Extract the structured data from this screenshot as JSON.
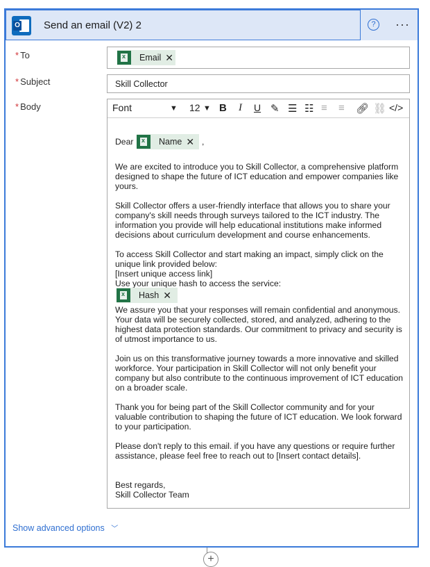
{
  "header": {
    "title": "Send an email (V2) 2",
    "help_glyph": "?",
    "more_glyph": "···"
  },
  "fields": {
    "to": {
      "label": "To",
      "required_mark": "*",
      "chip": "Email"
    },
    "subject": {
      "label": "Subject",
      "required_mark": "*",
      "value": "Skill Collector"
    },
    "body": {
      "label": "Body",
      "required_mark": "*"
    }
  },
  "toolbar": {
    "font": "Font",
    "size": "12",
    "bold": "B",
    "italic": "I",
    "underline": "U",
    "code": "</>"
  },
  "body": {
    "dear": "Dear",
    "name_chip": "Name",
    "comma": ",",
    "p1": "We are excited to introduce you to Skill Collector, a comprehensive platform\ndesigned to shape the future of ICT education and empower companies like\nyours.",
    "p2": "Skill Collector offers a user-friendly interface that allows you to share your\ncompany's skill needs through surveys tailored to the ICT industry. The\ninformation you provide will help educational institutions make informed\ndecisions about curriculum development and course enhancements.",
    "p3": "To access Skill Collector and start making an impact, simply click on the\nunique link provided below:\n[Insert unique access link]\nUse your unique hash to access the service:",
    "hash_chip": "Hash",
    "p4": "We assure you that your responses will remain confidential and anonymous.\nYour data will be securely collected, stored, and analyzed, adhering to the\nhighest data protection standards. Our commitment to privacy and security is\nof utmost importance to us.",
    "p5": "Join us on this transformative journey towards a more innovative and skilled\nworkforce. Your participation in Skill Collector will not only benefit your\ncompany but also contribute to the continuous improvement of ICT education\non a broader scale.",
    "p6": "Thank you for being part of the Skill Collector community and for your\nvaluable contribution to shaping the future of ICT education. We look forward\nto your participation.",
    "p7": "Please don't reply to this email. if you have any questions or require further\nassistance, please feel free to reach out to [Insert contact details].",
    "p8": "Best regards,\nSkill Collector Team"
  },
  "advanced": {
    "label": "Show advanced options"
  },
  "colors": {
    "accent": "#3b7ad9",
    "header_bg": "#dde7f7",
    "chip_bg": "#e1ede4",
    "excel": "#217346",
    "required": "#d13438"
  }
}
